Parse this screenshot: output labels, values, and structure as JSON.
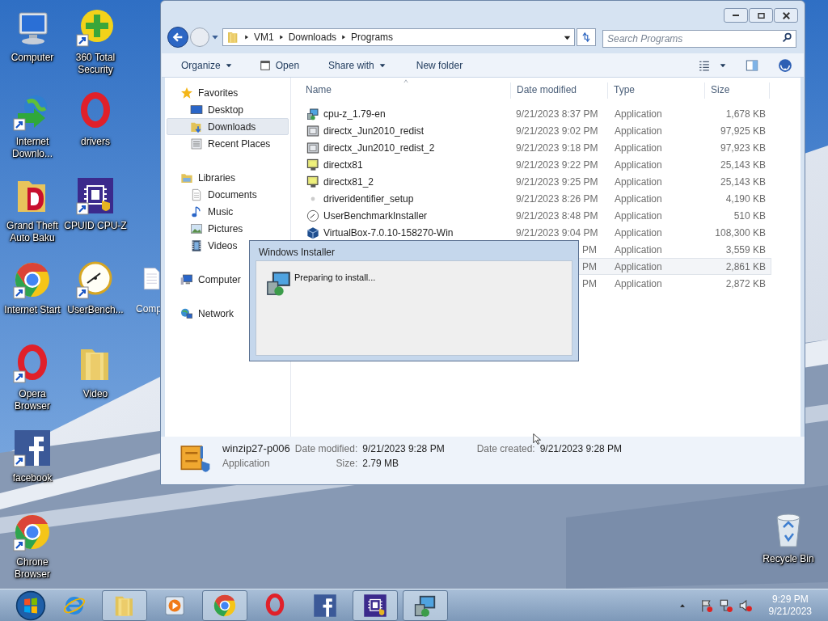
{
  "desktop_columns": [
    [
      {
        "label": "Computer",
        "kind": "computer",
        "shortcut": false
      },
      {
        "label": "Internet Downlo...",
        "kind": "globe",
        "shortcut": true
      },
      {
        "label": "Grand Theft Auto Baku",
        "kind": "gtafolder",
        "shortcut": false
      },
      {
        "label": "Internet Start",
        "kind": "chrome",
        "shortcut": true
      },
      {
        "label": "Opera Browser",
        "kind": "opera",
        "shortcut": true
      },
      {
        "label": "facebook",
        "kind": "facebook",
        "shortcut": true
      },
      {
        "label": "Chrone Browser",
        "kind": "chrome",
        "shortcut": true
      }
    ],
    [
      {
        "label": "360 Total Security",
        "kind": "plus",
        "shortcut": true
      },
      {
        "label": "drivers",
        "kind": "opera",
        "shortcut": false
      },
      {
        "label": "CPUID CPU-Z",
        "kind": "cpuz",
        "shortcut": true
      },
      {
        "label": "UserBench...",
        "kind": "gauge",
        "shortcut": true
      },
      {
        "label": "Video",
        "kind": "folder",
        "shortcut": false
      }
    ]
  ],
  "partial_icon": {
    "label": "Comp",
    "kind": "document"
  },
  "recycle_bin": {
    "label": "Recycle Bin",
    "kind": "recycle"
  },
  "explorer": {
    "breadcrumb": [
      "VM1",
      "Downloads",
      "Programs"
    ],
    "search": {
      "placeholder": "Search Programs"
    },
    "toolbar": [
      {
        "label": "Organize",
        "kind": "menu"
      },
      {
        "label": "Open",
        "kind": "open"
      },
      {
        "label": "Share with",
        "kind": "menu"
      },
      {
        "label": "New folder",
        "kind": "plain"
      }
    ],
    "nav": [
      {
        "label": "Favorites",
        "kind": "star",
        "selected": false,
        "children": [
          {
            "label": "Desktop",
            "kind": "desktop",
            "selected": false
          },
          {
            "label": "Downloads",
            "kind": "downloads",
            "selected": true
          },
          {
            "label": "Recent Places",
            "kind": "recent",
            "selected": false
          }
        ]
      },
      {
        "label": "Libraries",
        "kind": "libraries",
        "selected": false,
        "children": [
          {
            "label": "Documents",
            "kind": "documents",
            "selected": false
          },
          {
            "label": "Music",
            "kind": "music",
            "selected": false
          },
          {
            "label": "Pictures",
            "kind": "pictures",
            "selected": false
          },
          {
            "label": "Videos",
            "kind": "videos",
            "selected": false
          }
        ]
      },
      {
        "label": "Computer",
        "kind": "computer",
        "selected": false
      },
      {
        "label": "Network",
        "kind": "network",
        "selected": false
      }
    ],
    "columns": [
      "Name",
      "Date modified",
      "Type",
      "Size"
    ],
    "rows": [
      {
        "kind": "setup",
        "name": "cpu-z_1.79-en",
        "date": "9/21/2023 8:37 PM",
        "type": "Application",
        "size": "1,678 KB",
        "selected": false
      },
      {
        "kind": "dx",
        "name": "directx_Jun2010_redist",
        "date": "9/21/2023 9:02 PM",
        "type": "Application",
        "size": "97,925 KB",
        "selected": false
      },
      {
        "kind": "dx",
        "name": "directx_Jun2010_redist_2",
        "date": "9/21/2023 9:18 PM",
        "type": "Application",
        "size": "97,923 KB",
        "selected": false
      },
      {
        "kind": "monitor",
        "name": "directx81",
        "date": "9/21/2023 9:22 PM",
        "type": "Application",
        "size": "25,143 KB",
        "selected": false
      },
      {
        "kind": "monitor",
        "name": "directx81_2",
        "date": "9/21/2023 9:25 PM",
        "type": "Application",
        "size": "25,143 KB",
        "selected": false
      },
      {
        "kind": "blank",
        "name": "driveridentifier_setup",
        "date": "9/21/2023 8:26 PM",
        "type": "Application",
        "size": "4,190 KB",
        "selected": false
      },
      {
        "kind": "gauge",
        "name": "UserBenchmarkInstaller",
        "date": "9/21/2023 8:48 PM",
        "type": "Application",
        "size": "510 KB",
        "selected": false
      },
      {
        "kind": "box",
        "name": "VirtualBox-7.0.10-158270-Win",
        "date": "9/21/2023 9:04 PM",
        "type": "Application",
        "size": "108,300 KB",
        "selected": false
      },
      {
        "date": "PM",
        "type": "Application",
        "size": "3,559 KB",
        "selected": false
      },
      {
        "date": "PM",
        "type": "Application",
        "size": "2,861 KB",
        "selected": true
      },
      {
        "date": "PM",
        "type": "Application",
        "size": "2,872 KB",
        "selected": false
      }
    ],
    "details": {
      "name": "winzip27-p006",
      "type": "Application",
      "fields": [
        {
          "label": "Date modified:",
          "value": "9/21/2023 9:28 PM"
        },
        {
          "label": "Size:",
          "value": "2.79 MB"
        },
        {
          "label": "Date created:",
          "value": "9/21/2023 9:28 PM"
        }
      ]
    }
  },
  "dialog": {
    "title": "Windows Installer",
    "message": "Preparing to install..."
  },
  "taskbar": {
    "items": [
      {
        "kind": "ie",
        "running": false
      },
      {
        "kind": "folder",
        "running": true
      },
      {
        "kind": "media",
        "running": false
      },
      {
        "kind": "chrome",
        "running": true
      },
      {
        "kind": "opera",
        "running": false
      },
      {
        "kind": "facebook",
        "running": false
      },
      {
        "kind": "cpuz",
        "running": true
      },
      {
        "kind": "setup",
        "running": true
      }
    ],
    "time": "9:29 PM",
    "date": "9/21/2023"
  }
}
